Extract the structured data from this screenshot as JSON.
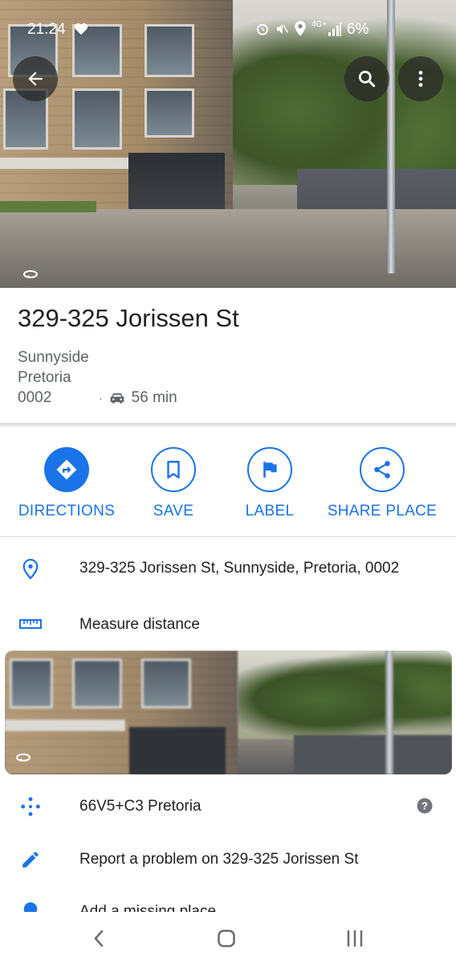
{
  "status_bar": {
    "time": "21:24",
    "battery": "6%",
    "network": "4G+"
  },
  "place": {
    "title": "329-325 Jorissen St",
    "suburb": "Sunnyside",
    "city": "Pretoria",
    "postal_code": "0002",
    "drive_time": "56 min"
  },
  "actions": [
    {
      "label": "DIRECTIONS"
    },
    {
      "label": "SAVE"
    },
    {
      "label": "LABEL"
    },
    {
      "label": "SHARE PLACE"
    }
  ],
  "rows": {
    "address": "329-325 Jorissen St, Sunnyside, Pretoria, 0002",
    "measure": "Measure distance",
    "plus_code": "66V5+C3 Pretoria",
    "report": "Report a problem on 329-325 Jorissen St",
    "add_place": "Add a missing place"
  },
  "colors": {
    "accent": "#1a73e8"
  }
}
